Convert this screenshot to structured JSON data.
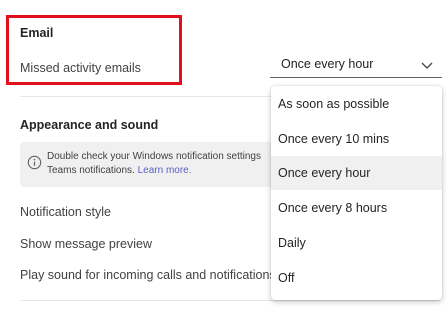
{
  "email": {
    "heading": "Email",
    "missed_activity_label": "Missed activity emails",
    "selected_value": "Once every hour",
    "options": [
      "As soon as possible",
      "Once every 10 mins",
      "Once every hour",
      "Once every 8 hours",
      "Daily",
      "Off"
    ],
    "selected_index": 2
  },
  "appearance": {
    "heading": "Appearance and sound",
    "banner_line1": "Double check your Windows notification settings",
    "banner_line2_prefix": "Teams notifications.",
    "banner_link": "Learn more."
  },
  "settings": {
    "notification_style": "Notification style",
    "show_message_preview": "Show message preview",
    "play_sound": "Play sound for incoming calls and notifications"
  },
  "colors": {
    "highlight_border": "#e3101b",
    "link": "#5b5fc7",
    "selected_option_bg": "#f0f0f0"
  },
  "icons": {
    "info": "info-icon",
    "dropdown": "chevron-down-icon"
  }
}
